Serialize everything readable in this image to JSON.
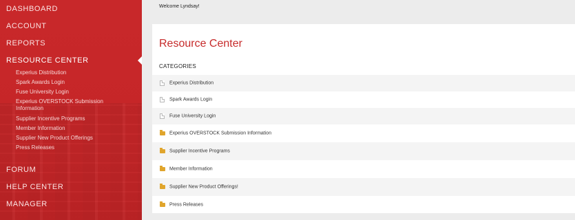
{
  "sidebar": {
    "main_items": [
      {
        "label": "DASHBOARD"
      },
      {
        "label": "ACCOUNT"
      },
      {
        "label": "REPORTS"
      },
      {
        "label": "RESOURCE CENTER"
      },
      {
        "label": "FORUM"
      },
      {
        "label": "HELP CENTER"
      },
      {
        "label": "MANAGER"
      }
    ],
    "sub_items": [
      {
        "label": "Experius Distribution"
      },
      {
        "label": "Spark Awards Login"
      },
      {
        "label": "Fuse University Login"
      },
      {
        "label": "Experius OVERSTOCK Submission Information"
      },
      {
        "label": "Supplier Incentive Programs"
      },
      {
        "label": "Member Information"
      },
      {
        "label": "Supplier New Product Offerings"
      },
      {
        "label": "Press Releases"
      }
    ]
  },
  "header": {
    "welcome": "Welcome Lyndsay!"
  },
  "main": {
    "title": "Resource Center",
    "categories_heading": "CATEGORIES",
    "categories": [
      {
        "label": "Experius Distribution",
        "icon": "document-icon"
      },
      {
        "label": "Spark Awards Login",
        "icon": "document-icon"
      },
      {
        "label": "Fuse University Login",
        "icon": "document-icon"
      },
      {
        "label": "Experius OVERSTOCK Submission Information",
        "icon": "folder-icon"
      },
      {
        "label": "Supplier Incentive Programs",
        "icon": "folder-icon"
      },
      {
        "label": "Member Information",
        "icon": "folder-icon"
      },
      {
        "label": "Supplier New Product Offerings!",
        "icon": "folder-icon"
      },
      {
        "label": "Press Releases",
        "icon": "folder-icon"
      }
    ]
  },
  "colors": {
    "sidebar_red": "#c62628",
    "title_red": "#c62a2a",
    "folder_gold": "#e0a52c"
  }
}
